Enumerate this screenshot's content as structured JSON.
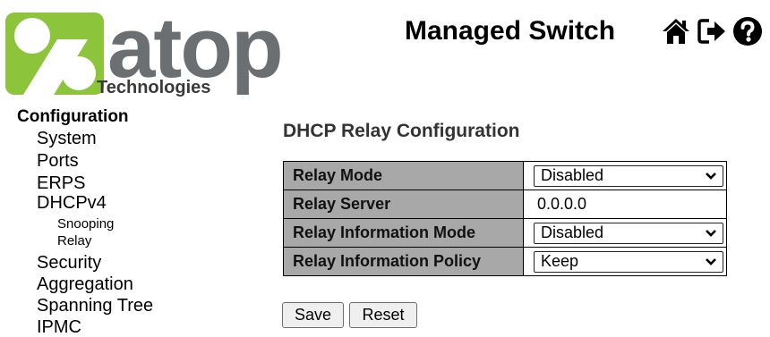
{
  "header": {
    "logo_wordmark": "atop",
    "logo_subtext": "Technologies",
    "app_title": "Managed Switch",
    "icons": [
      "home-icon",
      "logout-icon",
      "help-icon"
    ]
  },
  "sidebar": {
    "section": "Configuration",
    "items": [
      {
        "label": "System"
      },
      {
        "label": "Ports"
      },
      {
        "label": "ERPS"
      },
      {
        "label": "DHCPv4"
      },
      {
        "label": "Snooping"
      },
      {
        "label": "Relay"
      },
      {
        "label": "Security"
      },
      {
        "label": "Aggregation"
      },
      {
        "label": "Spanning Tree"
      },
      {
        "label": "IPMC"
      }
    ]
  },
  "main": {
    "title": "DHCP Relay Configuration",
    "rows": [
      {
        "label": "Relay Mode",
        "value": "Disabled",
        "control": "select"
      },
      {
        "label": "Relay Server",
        "value": "0.0.0.0",
        "control": "input"
      },
      {
        "label": "Relay Information Mode",
        "value": "Disabled",
        "control": "select"
      },
      {
        "label": "Relay Information Policy",
        "value": "Keep",
        "control": "select"
      }
    ],
    "buttons": {
      "save": "Save",
      "reset": "Reset"
    }
  },
  "colors": {
    "label_cell_bg": "#a8a8a8",
    "logo_green": "#8cc43c",
    "logo_gray": "#6c6f72"
  }
}
